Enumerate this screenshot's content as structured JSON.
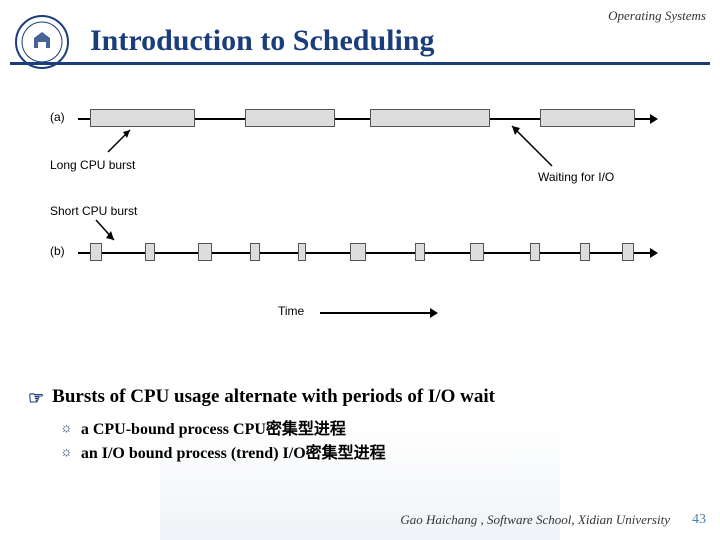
{
  "course_label": "Operating Systems",
  "title": "Introduction to Scheduling",
  "diagram": {
    "row_a_label": "(a)",
    "row_b_label": "(b)",
    "annot_long": "Long CPU burst",
    "annot_wait": "Waiting for I/O",
    "annot_short": "Short CPU burst",
    "annot_time": "Time"
  },
  "bullet": {
    "main": "Bursts of CPU usage alternate with periods of I/O wait",
    "subs": [
      "a CPU-bound process   CPU密集型进程",
      "an I/O bound process (trend)    I/O密集型进程"
    ]
  },
  "footer": "Gao Haichang ,  Software School,  Xidian University",
  "page": "43"
}
